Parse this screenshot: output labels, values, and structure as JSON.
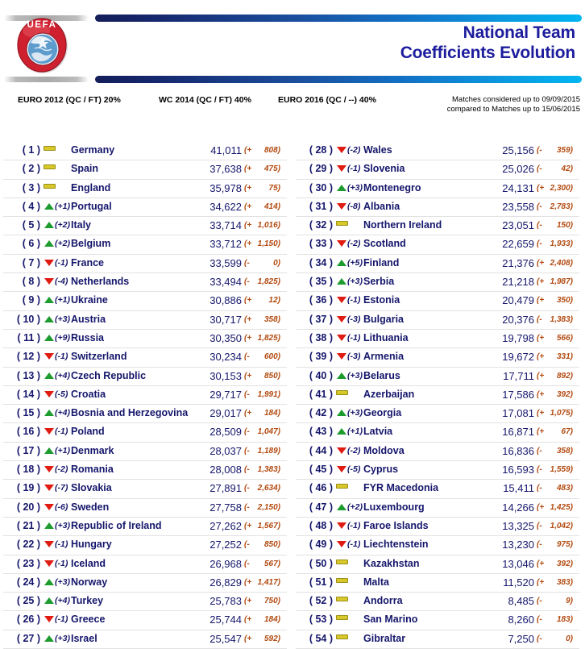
{
  "header": {
    "logo_alt": "uefa-logo",
    "title_line1": "National Team",
    "title_line2": "Coefficients Evolution",
    "title_color": "#1d1d9e"
  },
  "columns_header": {
    "euro2012": "EURO 2012  (QC / FT) 20%",
    "wc2014": "WC 2014  (QC / FT) 40%",
    "euro2016": "EURO 2016   (QC / --)  40%",
    "note_line1": "Matches considered up to 09/09/2015",
    "note_line2": "compared to Matches up to 15/06/2015"
  },
  "legend": {
    "up": "up-arrow-icon",
    "down": "down-arrow-icon",
    "same": "no-change-dash-icon"
  },
  "colors": {
    "rank_text": "#15166b",
    "points_text": "#15166b",
    "change_text": "#b24a10",
    "arrow_up": "#1e9b2e",
    "arrow_down": "#e01b12",
    "dash_same": "#d8c82a",
    "rule_blue_start": "#141e5a",
    "rule_blue_end": "#00b6f0"
  },
  "table": {
    "left": [
      {
        "rank": "( 1 )",
        "dir": "same",
        "delta": "",
        "team": "Germany",
        "points": "41,011",
        "sign": "(+",
        "change": "808)"
      },
      {
        "rank": "( 2 )",
        "dir": "same",
        "delta": "",
        "team": "Spain",
        "points": "37,638",
        "sign": "(+",
        "change": "475)"
      },
      {
        "rank": "( 3 )",
        "dir": "same",
        "delta": "",
        "team": "England",
        "points": "35,978",
        "sign": "(+",
        "change": "75)"
      },
      {
        "rank": "( 4 )",
        "dir": "up",
        "delta": "(+1)",
        "team": "Portugal",
        "points": "34,622",
        "sign": "(+",
        "change": "414)"
      },
      {
        "rank": "( 5 )",
        "dir": "up",
        "delta": "(+2)",
        "team": "Italy",
        "points": "33,714",
        "sign": "(+",
        "change": "1,016)"
      },
      {
        "rank": "( 6 )",
        "dir": "up",
        "delta": "(+2)",
        "team": "Belgium",
        "points": "33,712",
        "sign": "(+",
        "change": "1,150)"
      },
      {
        "rank": "( 7 )",
        "dir": "down",
        "delta": "(-1)",
        "team": "France",
        "points": "33,599",
        "sign": "(-",
        "change": "0)"
      },
      {
        "rank": "( 8 )",
        "dir": "down",
        "delta": "(-4)",
        "team": "Netherlands",
        "points": "33,494",
        "sign": "(-",
        "change": "1,825)"
      },
      {
        "rank": "( 9 )",
        "dir": "up",
        "delta": "(+1)",
        "team": "Ukraine",
        "points": "30,886",
        "sign": "(+",
        "change": "12)"
      },
      {
        "rank": "( 10 )",
        "dir": "up",
        "delta": "(+3)",
        "team": "Austria",
        "points": "30,717",
        "sign": "(+",
        "change": "358)"
      },
      {
        "rank": "( 11 )",
        "dir": "up",
        "delta": "(+9)",
        "team": "Russia",
        "points": "30,350",
        "sign": "(+",
        "change": "1,825)"
      },
      {
        "rank": "( 12 )",
        "dir": "down",
        "delta": "(-1)",
        "team": "Switzerland",
        "points": "30,234",
        "sign": "(-",
        "change": "600)"
      },
      {
        "rank": "( 13 )",
        "dir": "up",
        "delta": "(+4)",
        "team": "Czech Republic",
        "points": "30,153",
        "sign": "(+",
        "change": "850)"
      },
      {
        "rank": "( 14 )",
        "dir": "down",
        "delta": "(-5)",
        "team": "Croatia",
        "points": "29,717",
        "sign": "(-",
        "change": "1,991)"
      },
      {
        "rank": "( 15 )",
        "dir": "up",
        "delta": "(+4)",
        "team": "Bosnia and Herzegovina",
        "points": "29,017",
        "sign": "(+",
        "change": "184)"
      },
      {
        "rank": "( 16 )",
        "dir": "down",
        "delta": "(-1)",
        "team": "Poland",
        "points": "28,509",
        "sign": "(-",
        "change": "1,047)"
      },
      {
        "rank": "( 17 )",
        "dir": "up",
        "delta": "(+1)",
        "team": "Denmark",
        "points": "28,037",
        "sign": "(-",
        "change": "1,189)"
      },
      {
        "rank": "( 18 )",
        "dir": "down",
        "delta": "(-2)",
        "team": "Romania",
        "points": "28,008",
        "sign": "(-",
        "change": "1,383)"
      },
      {
        "rank": "( 19 )",
        "dir": "down",
        "delta": "(-7)",
        "team": "Slovakia",
        "points": "27,891",
        "sign": "(-",
        "change": "2,634)"
      },
      {
        "rank": "( 20 )",
        "dir": "down",
        "delta": "(-6)",
        "team": "Sweden",
        "points": "27,758",
        "sign": "(-",
        "change": "2,150)"
      },
      {
        "rank": "( 21 )",
        "dir": "up",
        "delta": "(+3)",
        "team": "Republic of Ireland",
        "points": "27,262",
        "sign": "(+",
        "change": "1,567)"
      },
      {
        "rank": "( 22 )",
        "dir": "down",
        "delta": "(-1)",
        "team": "Hungary",
        "points": "27,252",
        "sign": "(-",
        "change": "850)"
      },
      {
        "rank": "( 23 )",
        "dir": "down",
        "delta": "(-1)",
        "team": "Iceland",
        "points": "26,968",
        "sign": "(-",
        "change": "567)"
      },
      {
        "rank": "( 24 )",
        "dir": "up",
        "delta": "(+3)",
        "team": "Norway",
        "points": "26,829",
        "sign": "(+",
        "change": "1,417)"
      },
      {
        "rank": "( 25 )",
        "dir": "up",
        "delta": "(+4)",
        "team": "Turkey",
        "points": "25,783",
        "sign": "(+",
        "change": "750)"
      },
      {
        "rank": "( 26 )",
        "dir": "down",
        "delta": "(-1)",
        "team": "Greece",
        "points": "25,744",
        "sign": "(+",
        "change": "184)"
      },
      {
        "rank": "( 27 )",
        "dir": "up",
        "delta": "(+3)",
        "team": "Israel",
        "points": "25,547",
        "sign": "(+",
        "change": "592)"
      }
    ],
    "right": [
      {
        "rank": "( 28 )",
        "dir": "down",
        "delta": "(-2)",
        "team": "Wales",
        "points": "25,156",
        "sign": "(-",
        "change": "359)"
      },
      {
        "rank": "( 29 )",
        "dir": "down",
        "delta": "(-1)",
        "team": "Slovenia",
        "points": "25,026",
        "sign": "(-",
        "change": "42)"
      },
      {
        "rank": "( 30 )",
        "dir": "up",
        "delta": "(+3)",
        "team": "Montenegro",
        "points": "24,131",
        "sign": "(+",
        "change": "2,300)"
      },
      {
        "rank": "( 31 )",
        "dir": "down",
        "delta": "(-8)",
        "team": "Albania",
        "points": "23,558",
        "sign": "(-",
        "change": "2,783)"
      },
      {
        "rank": "( 32 )",
        "dir": "same",
        "delta": "",
        "team": "Northern Ireland",
        "points": "23,051",
        "sign": "(-",
        "change": "150)"
      },
      {
        "rank": "( 33 )",
        "dir": "down",
        "delta": "(-2)",
        "team": "Scotland",
        "points": "22,659",
        "sign": "(-",
        "change": "1,933)"
      },
      {
        "rank": "( 34 )",
        "dir": "up",
        "delta": "(+5)",
        "team": "Finland",
        "points": "21,376",
        "sign": "(+",
        "change": "2,408)"
      },
      {
        "rank": "( 35 )",
        "dir": "up",
        "delta": "(+3)",
        "team": "Serbia",
        "points": "21,218",
        "sign": "(+",
        "change": "1,987)"
      },
      {
        "rank": "( 36 )",
        "dir": "down",
        "delta": "(-1)",
        "team": "Estonia",
        "points": "20,479",
        "sign": "(+",
        "change": "350)"
      },
      {
        "rank": "( 37 )",
        "dir": "down",
        "delta": "(-3)",
        "team": "Bulgaria",
        "points": "20,376",
        "sign": "(-",
        "change": "1,383)"
      },
      {
        "rank": "( 38 )",
        "dir": "down",
        "delta": "(-1)",
        "team": "Lithuania",
        "points": "19,798",
        "sign": "(+",
        "change": "566)"
      },
      {
        "rank": "( 39 )",
        "dir": "down",
        "delta": "(-3)",
        "team": "Armenia",
        "points": "19,672",
        "sign": "(+",
        "change": "331)"
      },
      {
        "rank": "( 40 )",
        "dir": "up",
        "delta": "(+3)",
        "team": "Belarus",
        "points": "17,711",
        "sign": "(+",
        "change": "892)"
      },
      {
        "rank": "( 41 )",
        "dir": "same",
        "delta": "",
        "team": "Azerbaijan",
        "points": "17,586",
        "sign": "(+",
        "change": "392)"
      },
      {
        "rank": "( 42 )",
        "dir": "up",
        "delta": "(+3)",
        "team": "Georgia",
        "points": "17,081",
        "sign": "(+",
        "change": "1,075)"
      },
      {
        "rank": "( 43 )",
        "dir": "up",
        "delta": "(+1)",
        "team": "Latvia",
        "points": "16,871",
        "sign": "(+",
        "change": "67)"
      },
      {
        "rank": "( 44 )",
        "dir": "down",
        "delta": "(-2)",
        "team": "Moldova",
        "points": "16,836",
        "sign": "(-",
        "change": "358)"
      },
      {
        "rank": "( 45 )",
        "dir": "down",
        "delta": "(-5)",
        "team": "Cyprus",
        "points": "16,593",
        "sign": "(-",
        "change": "1,559)"
      },
      {
        "rank": "( 46 )",
        "dir": "same",
        "delta": "",
        "team": "FYR Macedonia",
        "points": "15,411",
        "sign": "(-",
        "change": "483)"
      },
      {
        "rank": "( 47 )",
        "dir": "up",
        "delta": "(+2)",
        "team": "Luxembourg",
        "points": "14,266",
        "sign": "(+",
        "change": "1,425)"
      },
      {
        "rank": "( 48 )",
        "dir": "down",
        "delta": "(-1)",
        "team": "Faroe Islands",
        "points": "13,325",
        "sign": "(-",
        "change": "1,042)"
      },
      {
        "rank": "( 49 )",
        "dir": "down",
        "delta": "(-1)",
        "team": "Liechtenstein",
        "points": "13,230",
        "sign": "(-",
        "change": "975)"
      },
      {
        "rank": "( 50 )",
        "dir": "same",
        "delta": "",
        "team": "Kazakhstan",
        "points": "13,046",
        "sign": "(+",
        "change": "392)"
      },
      {
        "rank": "( 51 )",
        "dir": "same",
        "delta": "",
        "team": "Malta",
        "points": "11,520",
        "sign": "(+",
        "change": "383)"
      },
      {
        "rank": "( 52 )",
        "dir": "same",
        "delta": "",
        "team": "Andorra",
        "points": "8,485",
        "sign": "(-",
        "change": "9)"
      },
      {
        "rank": "( 53 )",
        "dir": "same",
        "delta": "",
        "team": "San Marino",
        "points": "8,260",
        "sign": "(-",
        "change": "183)"
      },
      {
        "rank": "( 54 )",
        "dir": "same",
        "delta": "",
        "team": "Gibraltar",
        "points": "7,250",
        "sign": "(-",
        "change": "0)"
      }
    ]
  }
}
